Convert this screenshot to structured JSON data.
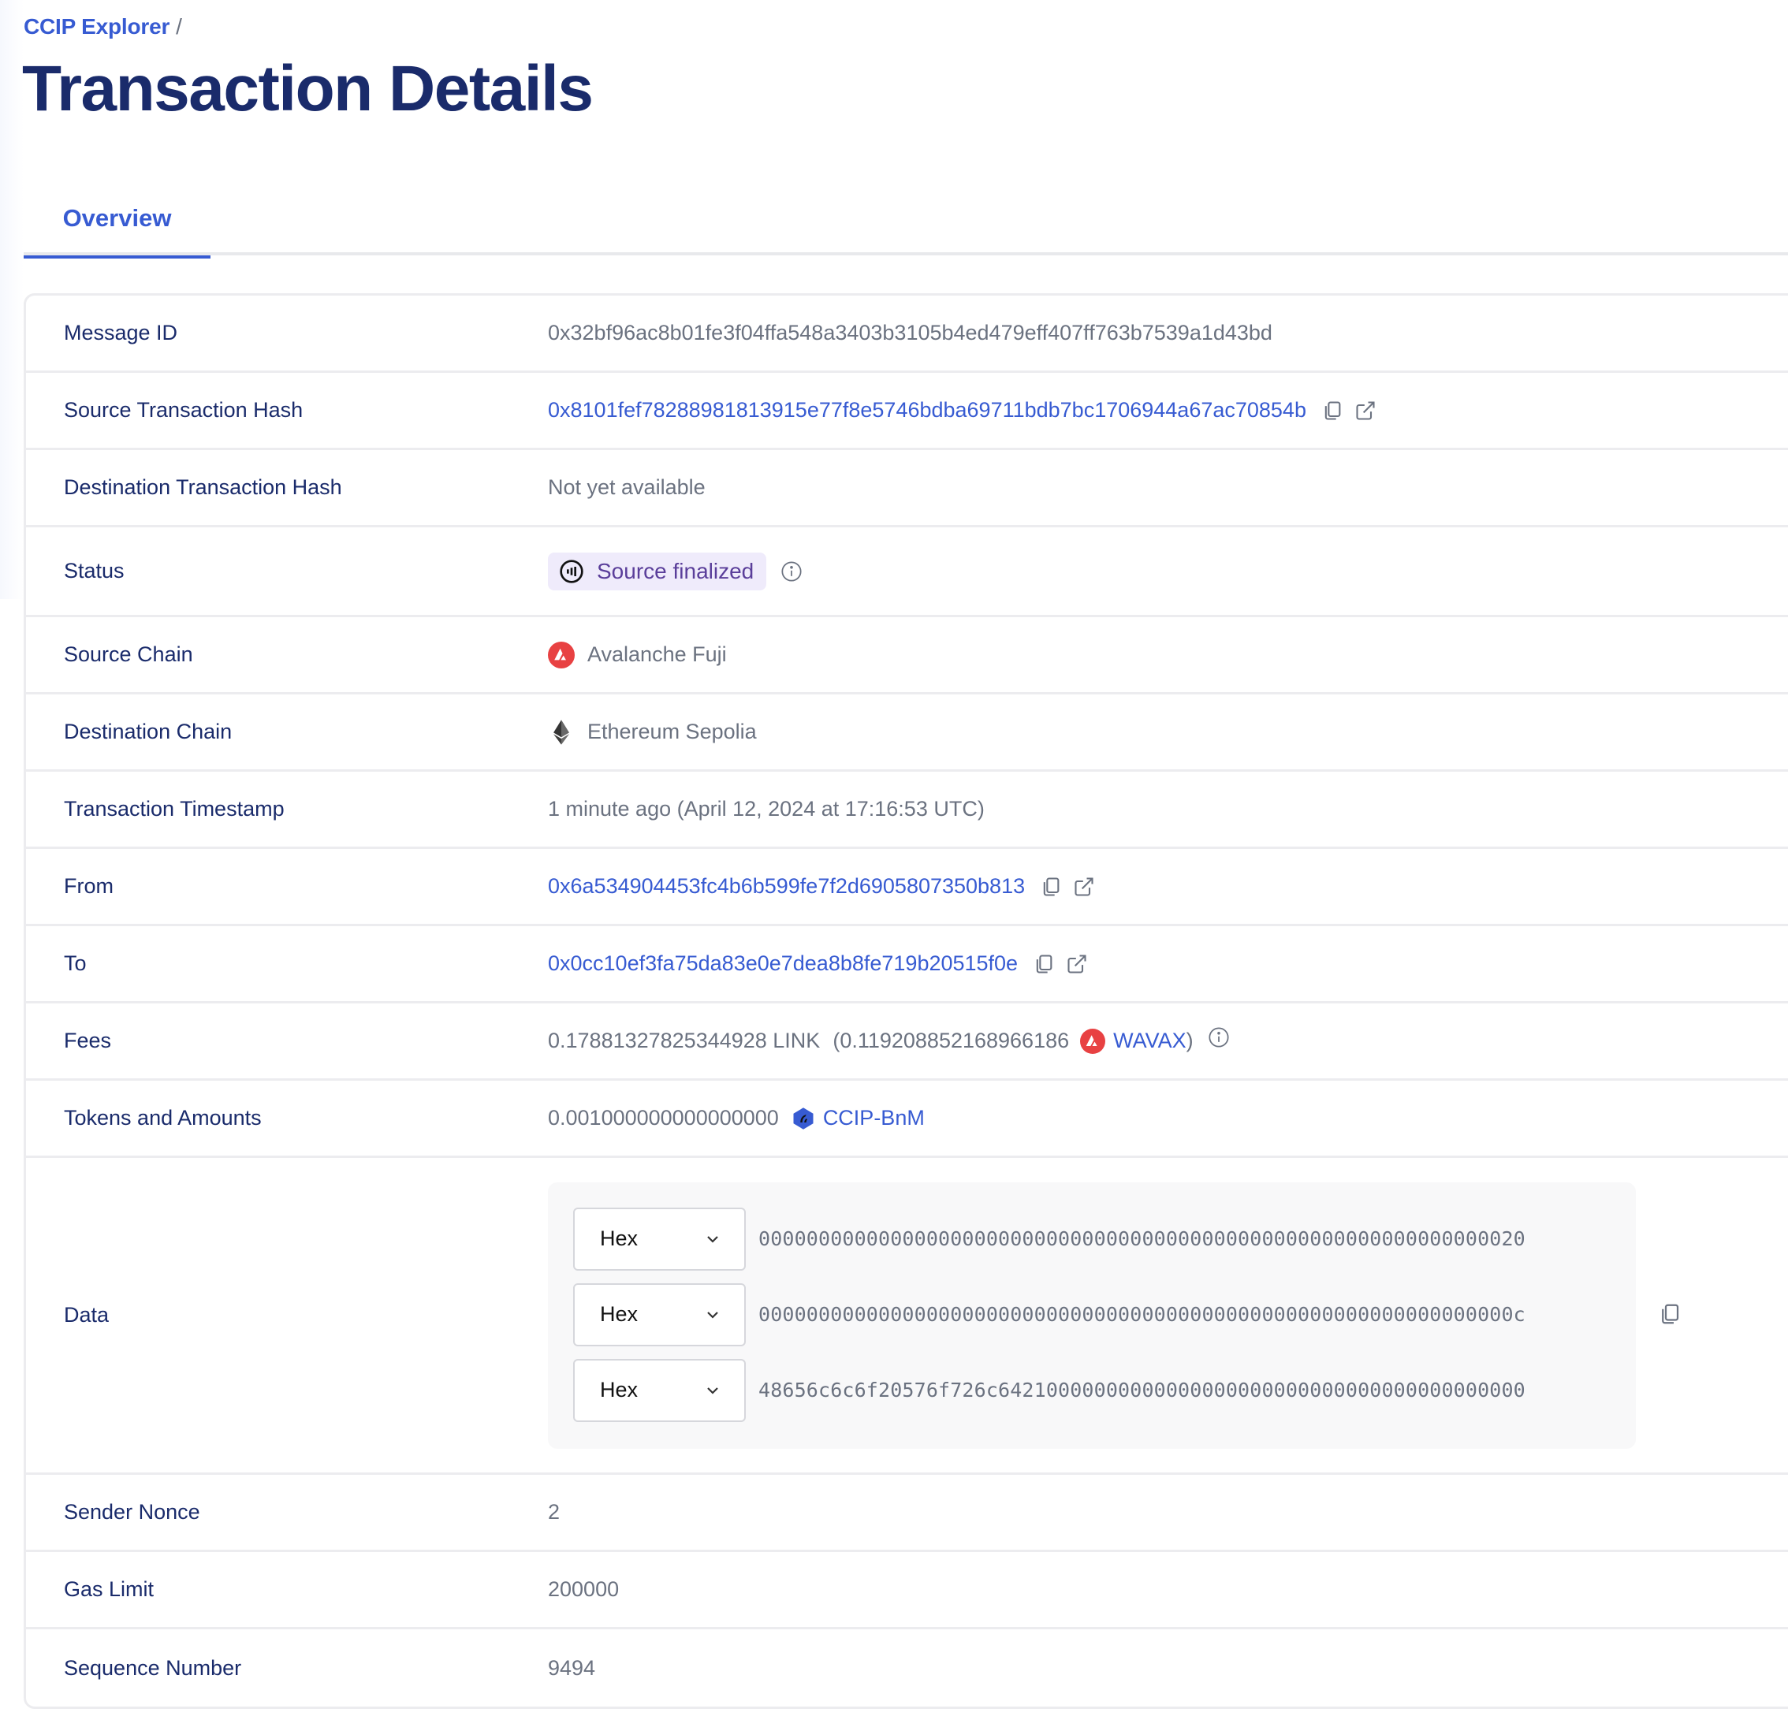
{
  "breadcrumb": {
    "root": "CCIP Explorer",
    "separator": "/"
  },
  "page_title": "Transaction Details",
  "tabs": [
    {
      "label": "Overview",
      "active": true
    }
  ],
  "colors": {
    "accent": "#375bd2",
    "heading": "#1a2b6b",
    "muted": "#6b7280",
    "status_bg": "#efebfb",
    "status_fg": "#5a3e9a",
    "avalanche": "#e84142"
  },
  "rows": {
    "message_id": {
      "label": "Message ID",
      "value": "0x32bf96ac8b01fe3f04ffa548a3403b3105b4ed479eff407ff763b7539a1d43bd"
    },
    "source_tx_hash": {
      "label": "Source Transaction Hash",
      "value": "0x8101fef78288981813915e77f8e5746bdba69711bdb7bc1706944a67ac70854b",
      "icons": [
        "copy-icon",
        "external-link-icon"
      ]
    },
    "dest_tx_hash": {
      "label": "Destination Transaction Hash",
      "value": "Not yet available"
    },
    "status": {
      "label": "Status",
      "value": "Source finalized",
      "icon": "status-progress-icon",
      "info_icon": "info-icon"
    },
    "source_chain": {
      "label": "Source Chain",
      "value": "Avalanche Fuji",
      "icon": "avalanche-icon"
    },
    "dest_chain": {
      "label": "Destination Chain",
      "value": "Ethereum Sepolia",
      "icon": "ethereum-icon"
    },
    "timestamp": {
      "label": "Transaction Timestamp",
      "value": "1 minute ago (April 12, 2024 at 17:16:53 UTC)"
    },
    "from": {
      "label": "From",
      "value": "0x6a534904453fc4b6b599fe7f2d6905807350b813",
      "icons": [
        "copy-icon",
        "external-link-icon"
      ]
    },
    "to": {
      "label": "To",
      "value": "0x0cc10ef3fa75da83e0e7dea8b8fe719b20515f0e",
      "icons": [
        "copy-icon",
        "external-link-icon"
      ]
    },
    "fees": {
      "label": "Fees",
      "amount": "0.17881327825344928 LINK",
      "alt_amount": "(0.119208852168966186",
      "alt_token": "WAVAX",
      "close_paren": ")",
      "token_icon": "avalanche-icon",
      "info_icon": "info-icon"
    },
    "tokens": {
      "label": "Tokens and Amounts",
      "amount": "0.001000000000000000",
      "token": "CCIP-BnM",
      "token_icon": "ccip-bnm-icon"
    },
    "data": {
      "label": "Data",
      "lines": [
        {
          "format": "Hex",
          "value": "0000000000000000000000000000000000000000000000000000000000000020"
        },
        {
          "format": "Hex",
          "value": "000000000000000000000000000000000000000000000000000000000000000c"
        },
        {
          "format": "Hex",
          "value": "48656c6c6f20576f726c64210000000000000000000000000000000000000000"
        }
      ],
      "copy_icon": "copy-icon"
    },
    "sender_nonce": {
      "label": "Sender Nonce",
      "value": "2"
    },
    "gas_limit": {
      "label": "Gas Limit",
      "value": "200000"
    },
    "sequence_number": {
      "label": "Sequence Number",
      "value": "9494"
    }
  }
}
